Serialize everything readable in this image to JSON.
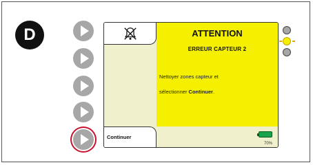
{
  "step_label": "D",
  "screen": {
    "title": "ATTENTION",
    "subtitle": "ERREUR CAPTEUR 2",
    "message_line1": "Nettoyer zones capteur et",
    "message_line2_prefix": "sélectionner ",
    "message_line2_bold": "Continuer",
    "message_line2_suffix": ".",
    "softkey_label": "Continuer",
    "battery_percent": "70%",
    "battery_level": 0.7,
    "icon": "muted-alarm-icon"
  },
  "side_buttons": [
    {
      "icon": "play-icon",
      "highlighted": false
    },
    {
      "icon": "play-icon",
      "highlighted": false
    },
    {
      "icon": "play-icon",
      "highlighted": false
    },
    {
      "icon": "play-icon",
      "highlighted": false
    },
    {
      "icon": "play-icon",
      "highlighted": true
    }
  ],
  "leds": [
    {
      "state": "off",
      "color": "#a7a7a7"
    },
    {
      "state": "on",
      "color": "#f4f000"
    },
    {
      "state": "off",
      "color": "#a7a7a7"
    }
  ],
  "colors": {
    "alert_yellow": "#f4f000",
    "highlight_ring": "#c8102e",
    "battery_green": "#1aa34a"
  }
}
